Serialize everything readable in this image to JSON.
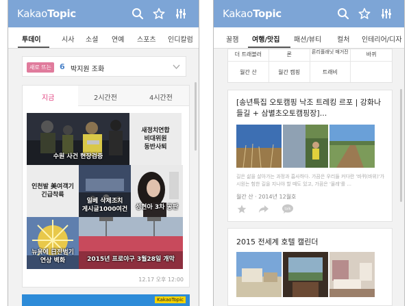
{
  "left": {
    "logo": {
      "kakao": "Kakao",
      "topic": "Topic"
    },
    "tabs": [
      "투데이",
      "시사",
      "소셜",
      "연예",
      "스포츠",
      "인디칼럼"
    ],
    "trending": {
      "badge": "새로 뜨는",
      "rank": "6",
      "text": "박지원 조화"
    },
    "time_tabs": [
      "지금",
      "2시간전",
      "4시간전"
    ],
    "tiles": {
      "t1": "수원 사건 현장검증",
      "t2": "새정치연합\n비대위원\n동반사퇴",
      "t3": "인천발 美여객기\n긴급착륙",
      "t4": "일베 삭제조치\n게시글1000여건",
      "t5": "성현아 3차 공판",
      "t6": "뉴욕에 日전범기\n연상 벽화",
      "t7": "2015년 프로야구 3월28일 개막"
    },
    "timestamp": "12.17 오후 12:00",
    "banner_logo": "KakaoTopic"
  },
  "right": {
    "logo": {
      "kakao": "Kakao",
      "topic": "Topic"
    },
    "tabs": [
      "꿀잼",
      "여행/맛집",
      "패션/뷰티",
      "컬처",
      "인테리어/디자"
    ],
    "grid": [
      "더 트래블러",
      "론",
      "론리플래닛 매거진",
      "바퀴",
      "월간 산",
      "월간 캠핑",
      "트래비",
      ""
    ],
    "article1": {
      "title": "[송년특집 오토캠핑 낙조 트레킹 르포 | 강화나들길 + 삼별초오토캠핑장]...",
      "excerpt": "길은 삶을 살아가는 과정과 흡사하다. 가끔은 우리들 커다란 '바퀴(바위)'가 시원는 험한 길을 지나야 할 때도 있고, 가끔은 '올레'를 ...",
      "meta": "월간 산 · 2014년 12월호"
    },
    "article2": {
      "title": "2015 전세계 호텔 캘린더"
    }
  },
  "colors": {
    "appbar": "#7da5d6",
    "badge": "#e07b9c",
    "accent_pink": "#e1417f",
    "number_blue": "#4a82c8"
  }
}
